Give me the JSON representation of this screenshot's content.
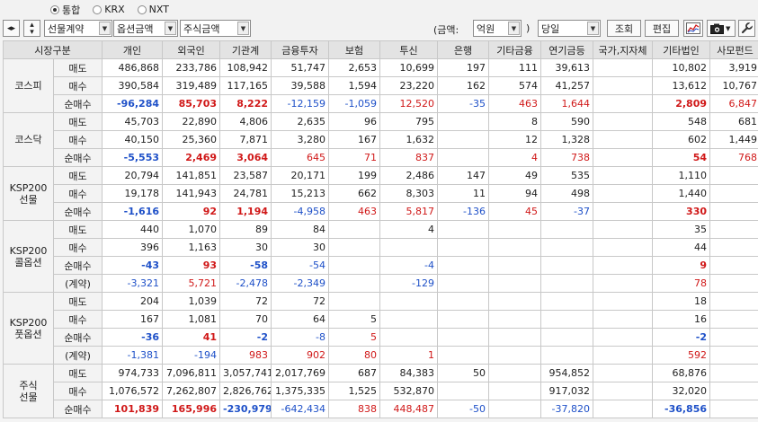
{
  "market_options": [
    {
      "label": "통합",
      "checked": true
    },
    {
      "label": "KRX",
      "checked": false
    },
    {
      "label": "NXT",
      "checked": false
    }
  ],
  "controls": {
    "futures_select": "선물계약",
    "options_select": "옵션금액",
    "stock_select": "주식금액",
    "amount_label": "(금액:",
    "unit_select": "억원",
    "close_paren": ")",
    "period_select": "당일",
    "query_button": "조회",
    "edit_button": "편집"
  },
  "columns": [
    "시장구분",
    "",
    "개인",
    "외국인",
    "기관계",
    "금융투자",
    "보험",
    "투신",
    "은행",
    "기타금융",
    "연기금등",
    "국가,지자체",
    "기타법인",
    "사모펀드"
  ],
  "groups": [
    {
      "name": "코스피",
      "rows": [
        {
          "label": "매도",
          "values": [
            "486,868",
            "233,786",
            "108,942",
            "51,747",
            "2,653",
            "10,699",
            "197",
            "111",
            "39,613",
            "",
            "10,802",
            "3,919"
          ]
        },
        {
          "label": "매수",
          "values": [
            "390,584",
            "319,489",
            "117,165",
            "39,588",
            "1,594",
            "23,220",
            "162",
            "574",
            "41,257",
            "",
            "13,612",
            "10,767"
          ]
        },
        {
          "label": "순매수",
          "net": true,
          "values": [
            "-96,284",
            "85,703",
            "8,222",
            "-12,159",
            "-1,059",
            "12,520",
            "-35",
            "463",
            "1,644",
            "",
            "2,809",
            "6,847"
          ]
        }
      ]
    },
    {
      "name": "코스닥",
      "rows": [
        {
          "label": "매도",
          "values": [
            "45,703",
            "22,890",
            "4,806",
            "2,635",
            "96",
            "795",
            "",
            "8",
            "590",
            "",
            "548",
            "681"
          ]
        },
        {
          "label": "매수",
          "values": [
            "40,150",
            "25,360",
            "7,871",
            "3,280",
            "167",
            "1,632",
            "",
            "12",
            "1,328",
            "",
            "602",
            "1,449"
          ]
        },
        {
          "label": "순매수",
          "net": true,
          "values": [
            "-5,553",
            "2,469",
            "3,064",
            "645",
            "71",
            "837",
            "",
            "4",
            "738",
            "",
            "54",
            "768"
          ]
        }
      ]
    },
    {
      "name": "KSP200\n선물",
      "rows": [
        {
          "label": "매도",
          "values": [
            "20,794",
            "141,851",
            "23,587",
            "20,171",
            "199",
            "2,486",
            "147",
            "49",
            "535",
            "",
            "1,110",
            ""
          ]
        },
        {
          "label": "매수",
          "values": [
            "19,178",
            "141,943",
            "24,781",
            "15,213",
            "662",
            "8,303",
            "11",
            "94",
            "498",
            "",
            "1,440",
            ""
          ]
        },
        {
          "label": "순매수",
          "net": true,
          "values": [
            "-1,616",
            "92",
            "1,194",
            "-4,958",
            "463",
            "5,817",
            "-136",
            "45",
            "-37",
            "",
            "330",
            ""
          ]
        }
      ]
    },
    {
      "name": "KSP200\n콜옵션",
      "rows": [
        {
          "label": "매도",
          "values": [
            "440",
            "1,070",
            "89",
            "84",
            "",
            "4",
            "",
            "",
            "",
            "",
            "35",
            ""
          ]
        },
        {
          "label": "매수",
          "values": [
            "396",
            "1,163",
            "30",
            "30",
            "",
            "",
            "",
            "",
            "",
            "",
            "44",
            ""
          ]
        },
        {
          "label": "순매수",
          "net": true,
          "values": [
            "-43",
            "93",
            "-58",
            "-54",
            "",
            "-4",
            "",
            "",
            "",
            "",
            "9",
            ""
          ]
        },
        {
          "label": "(계약)",
          "net": true,
          "contract": true,
          "values": [
            "-3,321",
            "5,721",
            "-2,478",
            "-2,349",
            "",
            "-129",
            "",
            "",
            "",
            "",
            "78",
            ""
          ]
        }
      ]
    },
    {
      "name": "KSP200\n풋옵션",
      "rows": [
        {
          "label": "매도",
          "values": [
            "204",
            "1,039",
            "72",
            "72",
            "",
            "",
            "",
            "",
            "",
            "",
            "18",
            ""
          ]
        },
        {
          "label": "매수",
          "values": [
            "167",
            "1,081",
            "70",
            "64",
            "5",
            "",
            "",
            "",
            "",
            "",
            "16",
            ""
          ]
        },
        {
          "label": "순매수",
          "net": true,
          "values": [
            "-36",
            "41",
            "-2",
            "-8",
            "5",
            "",
            "",
            "",
            "",
            "",
            "-2",
            ""
          ]
        },
        {
          "label": "(계약)",
          "net": true,
          "contract": true,
          "values": [
            "-1,381",
            "-194",
            "983",
            "902",
            "80",
            "1",
            "",
            "",
            "",
            "",
            "592",
            ""
          ]
        }
      ]
    },
    {
      "name": "주식\n선물",
      "rows": [
        {
          "label": "매도",
          "values": [
            "974,733",
            "7,096,811",
            "3,057,741",
            "2,017,769",
            "687",
            "84,383",
            "50",
            "",
            "954,852",
            "",
            "68,876",
            ""
          ]
        },
        {
          "label": "매수",
          "values": [
            "1,076,572",
            "7,262,807",
            "2,826,762",
            "1,375,335",
            "1,525",
            "532,870",
            "",
            "",
            "917,032",
            "",
            "32,020",
            ""
          ]
        },
        {
          "label": "순매수",
          "net": true,
          "values": [
            "101,839",
            "165,996",
            "-230,979",
            "-642,434",
            "838",
            "448,487",
            "-50",
            "",
            "-37,820",
            "",
            "-36,856",
            ""
          ]
        }
      ]
    }
  ]
}
